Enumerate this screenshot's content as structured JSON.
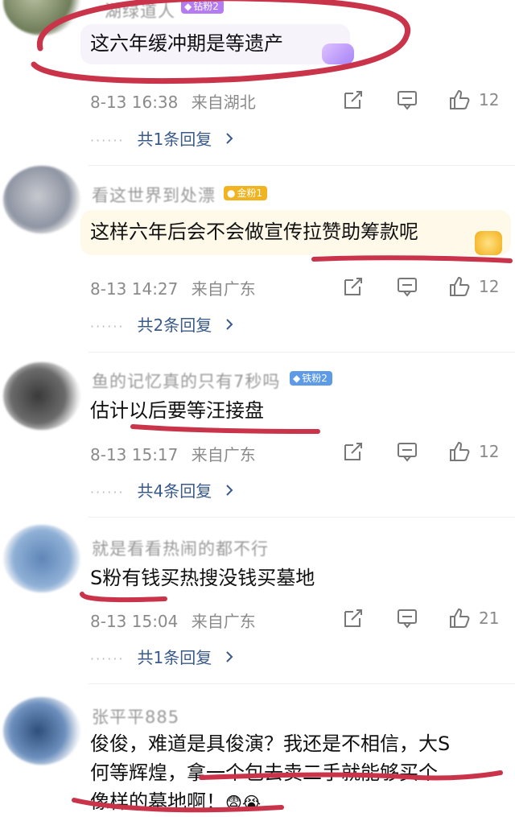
{
  "comments": [
    {
      "username": "湖绿道人",
      "badge": "钻粉2",
      "text": "这六年缓冲期是等遗产",
      "time": "8-13 16:38",
      "location": "来自湖北",
      "likes": "12",
      "replies": "共1条回复"
    },
    {
      "username": "看这世界到处漂",
      "badge": "金粉1",
      "text": "这样六年后会不会做宣传拉赞助筹款呢",
      "time": "8-13 14:27",
      "location": "来自广东",
      "likes": "12",
      "replies": "共2条回复"
    },
    {
      "username": "鱼的记忆真的只有7秒吗",
      "badge": "铁粉2",
      "text": "估计以后要等汪接盘",
      "time": "8-13 15:17",
      "location": "来自广东",
      "likes": "12",
      "replies": "共4条回复"
    },
    {
      "username": "就是看看热闹的都不行",
      "text": "S粉有钱买热搜没钱买墓地",
      "time": "8-13 15:04",
      "location": "来自广东",
      "likes": "21",
      "replies": "共1条回复"
    },
    {
      "username": "张平平885",
      "text_line1": "俊俊，难道是具俊演？我还是不相信，大S",
      "text_line2": "何等辉煌，拿一个包去卖二手就能够买个",
      "text_line3": "像样的墓地啊！",
      "emoji": "😨😭"
    }
  ],
  "colors": {
    "highlight_red": "#c9344a",
    "reply_blue": "#3a5a8a",
    "badge_diamond": "#b47cf0",
    "badge_gold": "#f2b320",
    "badge_iron": "#5d9be6"
  },
  "icons": [
    "share-icon",
    "comment-icon",
    "like-icon",
    "chevron-right-icon"
  ]
}
